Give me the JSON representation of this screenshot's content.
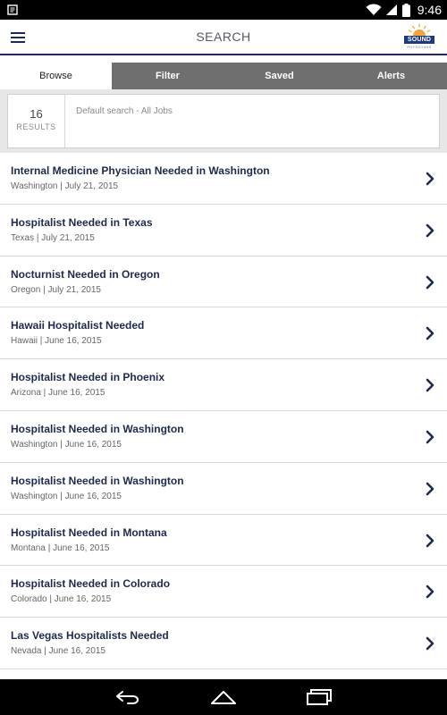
{
  "status_bar": {
    "time": "9:46"
  },
  "app_bar": {
    "title": "SEARCH",
    "logo_text": "SOUND",
    "logo_subtext": "PHYSICIANS"
  },
  "tabs": [
    {
      "label": "Browse",
      "active": true
    },
    {
      "label": "Filter",
      "active": false
    },
    {
      "label": "Saved",
      "active": false
    },
    {
      "label": "Alerts",
      "active": false
    }
  ],
  "summary": {
    "count": "16",
    "count_label": "RESULTS",
    "search_description": "Default search - All Jobs"
  },
  "jobs": [
    {
      "title": "Internal Medicine Physician Needed in Washington",
      "meta": "Washington | July 21, 2015"
    },
    {
      "title": "Hospitalist Needed in Texas",
      "meta": "Texas | July 21, 2015"
    },
    {
      "title": "Nocturnist Needed in Oregon",
      "meta": "Oregon | July 21, 2015"
    },
    {
      "title": "Hawaii Hospitalist Needed",
      "meta": "Hawaii | June 16, 2015"
    },
    {
      "title": "Hospitalist Needed in Phoenix",
      "meta": "Arizona | June 16, 2015"
    },
    {
      "title": "Hospitalist Needed in Washington",
      "meta": "Washington | June 16, 2015"
    },
    {
      "title": "Hospitalist Needed in Washington",
      "meta": "Washington | June 16, 2015"
    },
    {
      "title": "Hospitalist Needed in Montana",
      "meta": "Montana | June 16, 2015"
    },
    {
      "title": "Hospitalist Needed in Colorado",
      "meta": "Colorado | June 16, 2015"
    },
    {
      "title": "Las Vegas Hospitalists Needed",
      "meta": "Nevada | June 16, 2015"
    }
  ],
  "colors": {
    "brand_navy": "#1e2a4e",
    "tab_bar": "#6f6f6f",
    "logo_blue": "#1f3a7a",
    "logo_sun": "#f2a33a"
  },
  "icons": {
    "menu": "hamburger-menu-icon",
    "row_action": "chevron-right-icon",
    "nav_back": "back-icon",
    "nav_home": "home-icon",
    "nav_recents": "recents-icon"
  }
}
